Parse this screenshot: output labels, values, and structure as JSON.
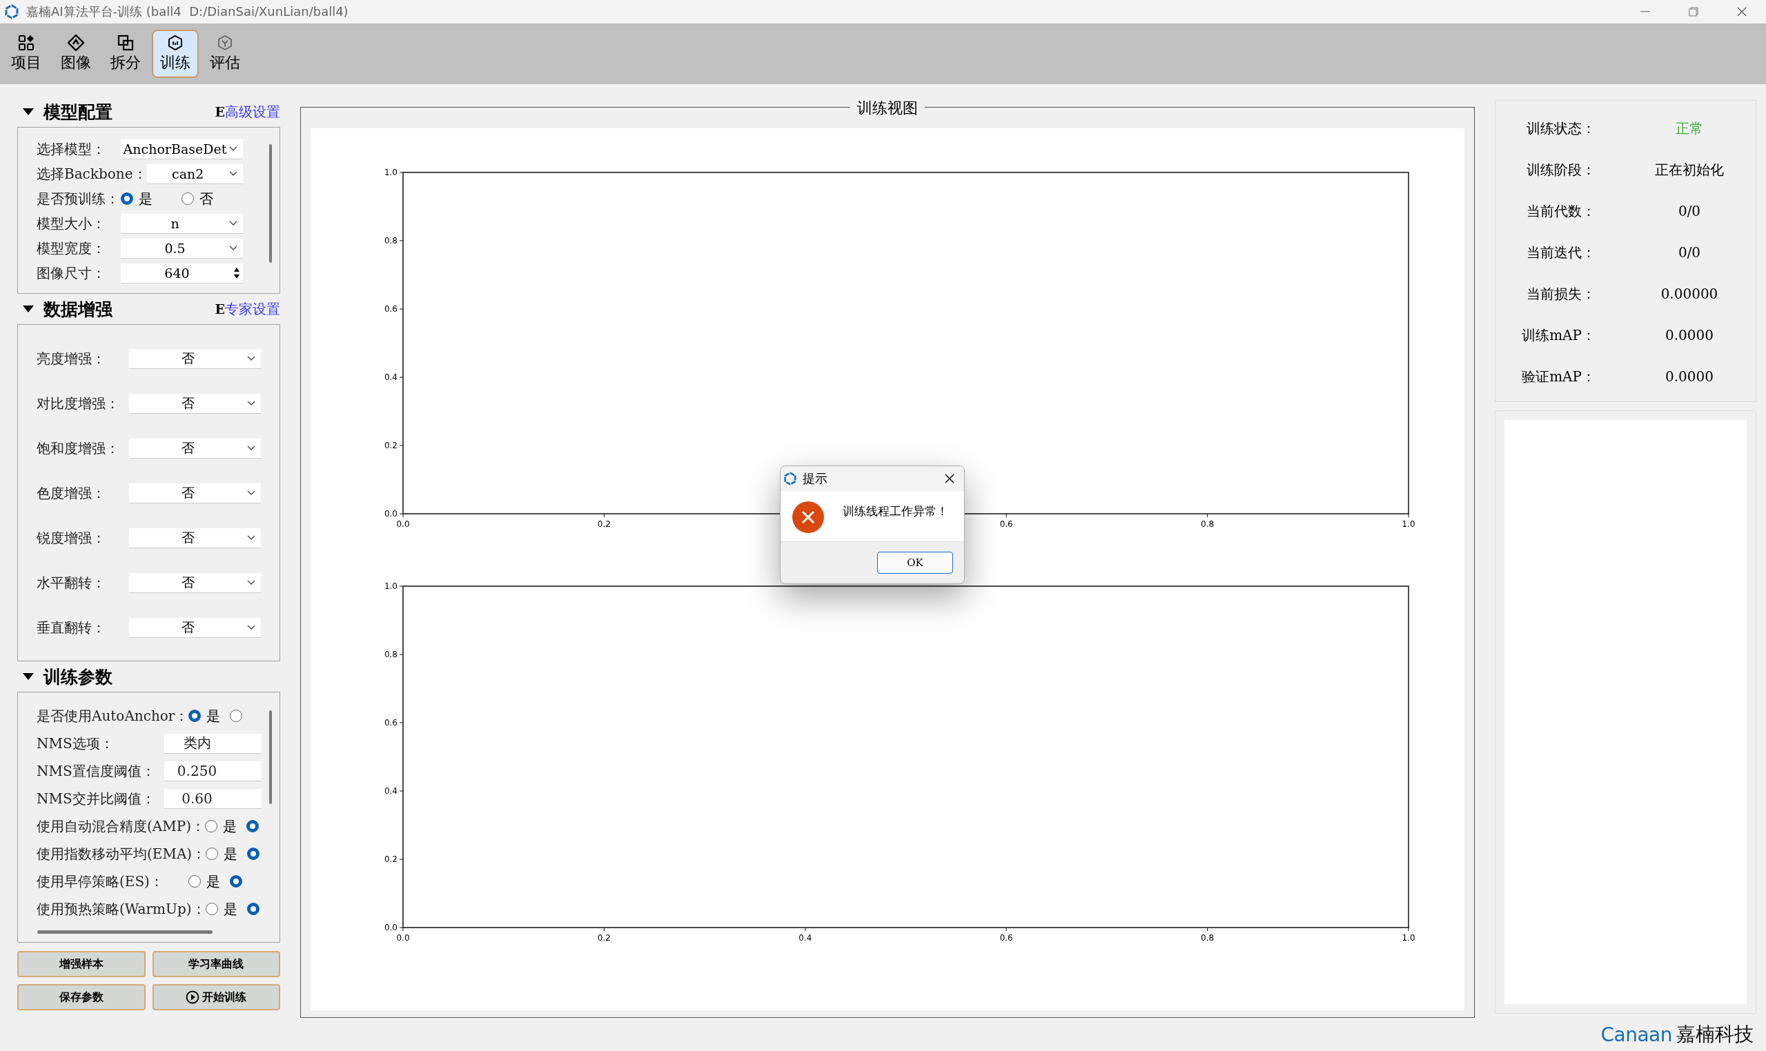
{
  "window": {
    "title": "嘉楠AI算法平台-训练 (ball4  D:/DianSai/XunLian/ball4)"
  },
  "toolbar": [
    {
      "label": "项目",
      "selected": false
    },
    {
      "label": "图像",
      "selected": false
    },
    {
      "label": "拆分",
      "selected": false
    },
    {
      "label": "训练",
      "selected": true
    },
    {
      "label": "评估",
      "selected": false
    }
  ],
  "model_config": {
    "title": "模型配置",
    "link_mark": "E",
    "link": "高级设置",
    "rows": [
      {
        "kind": "select",
        "label": "选择模型：",
        "value": "AnchorBaseDet"
      },
      {
        "kind": "select",
        "label": "选择Backbone：",
        "value": "can2"
      },
      {
        "kind": "radio",
        "label": "是否预训练：",
        "options": [
          {
            "label": "是",
            "selected": true
          },
          {
            "label": "否",
            "selected": false
          }
        ]
      },
      {
        "kind": "select",
        "label": "模型大小：",
        "value": "n"
      },
      {
        "kind": "select",
        "label": "模型宽度：",
        "value": "0.5"
      },
      {
        "kind": "spin",
        "label": "图像尺寸：",
        "value": "640"
      }
    ]
  },
  "augmentation": {
    "title": "数据增强",
    "link_mark": "E",
    "link": "专家设置",
    "rows": [
      {
        "label": "亮度增强：",
        "value": "否"
      },
      {
        "label": "对比度增强：",
        "value": "否"
      },
      {
        "label": "饱和度增强：",
        "value": "否"
      },
      {
        "label": "色度增强：",
        "value": "否"
      },
      {
        "label": "锐度增强：",
        "value": "否"
      },
      {
        "label": "水平翻转：",
        "value": "否"
      },
      {
        "label": "垂直翻转：",
        "value": "否"
      }
    ]
  },
  "train_params": {
    "title": "训练参数",
    "rows": [
      {
        "kind": "radio",
        "label": "是否使用AutoAnchor：",
        "options": [
          {
            "label": "是",
            "selected": true
          },
          {
            "selected": false
          }
        ]
      },
      {
        "kind": "field",
        "label": "NMS选项：",
        "value": "类内"
      },
      {
        "kind": "field",
        "label": "NMS置信度阈值：",
        "value": "0.250"
      },
      {
        "kind": "field",
        "label": "NMS交并比阈值：",
        "value": "0.60"
      },
      {
        "kind": "radio",
        "label": "使用自动混合精度(AMP)：",
        "options": [
          {
            "label": "是",
            "selected": false
          },
          {
            "selected": true
          }
        ]
      },
      {
        "kind": "radio",
        "label": "使用指数移动平均(EMA)：",
        "options": [
          {
            "label": "是",
            "selected": false
          },
          {
            "selected": true
          }
        ]
      },
      {
        "kind": "radio",
        "label": "使用早停策略(ES)：",
        "options": [
          {
            "label": "是",
            "selected": false
          },
          {
            "selected": true
          }
        ]
      },
      {
        "kind": "radio",
        "label": "使用预热策略(WarmUp)：",
        "options": [
          {
            "label": "是",
            "selected": false
          },
          {
            "selected": true
          }
        ]
      }
    ]
  },
  "actions": [
    {
      "kind": "plain",
      "label": "增强样本"
    },
    {
      "kind": "plain",
      "label": "学习率曲线"
    },
    {
      "kind": "plain",
      "label": "保存参数"
    },
    {
      "kind": "play",
      "label": "开始训练"
    }
  ],
  "view": {
    "title": "训练视图",
    "charts": [
      {
        "chart_data": {
          "type": "line",
          "xlim": [
            0,
            1
          ],
          "ylim": [
            0,
            1
          ],
          "xticks": [
            {
              "value": 0,
              "label": "0.0"
            },
            {
              "value": 0.2,
              "label": "0.2"
            },
            {
              "value": 0.6,
              "label": "0.6"
            },
            {
              "value": 0.8,
              "label": "0.8"
            },
            {
              "value": 1,
              "label": "1.0"
            }
          ],
          "yticks": [
            {
              "value": 0,
              "label": "0.0"
            },
            {
              "value": 0.2,
              "label": "0.2"
            },
            {
              "value": 0.4,
              "label": "0.4"
            },
            {
              "value": 0.6,
              "label": "0.6"
            },
            {
              "value": 0.8,
              "label": "0.8"
            },
            {
              "value": 1,
              "label": "1.0"
            }
          ]
        }
      },
      {
        "chart_data": {
          "type": "line",
          "xlim": [
            0,
            1
          ],
          "ylim": [
            0,
            1
          ],
          "xticks": [
            {
              "value": 0,
              "label": "0.0"
            },
            {
              "value": 0.2,
              "label": "0.2"
            },
            {
              "value": 0.4,
              "label": "0.4"
            },
            {
              "value": 0.6,
              "label": "0.6"
            },
            {
              "value": 0.8,
              "label": "0.8"
            },
            {
              "value": 1,
              "label": "1.0"
            }
          ],
          "yticks": [
            {
              "value": 0,
              "label": "0.0"
            },
            {
              "value": 0.2,
              "label": "0.2"
            },
            {
              "value": 0.4,
              "label": "0.4"
            },
            {
              "value": 0.6,
              "label": "0.6"
            },
            {
              "value": 0.8,
              "label": "0.8"
            },
            {
              "value": 1,
              "label": "1.0"
            }
          ]
        }
      }
    ]
  },
  "status": [
    {
      "label": "训练状态：",
      "value": "正常",
      "color": "#3aa83a"
    },
    {
      "label": "训练阶段：",
      "value": "正在初始化",
      "color": "#000000"
    },
    {
      "label": "当前代数：",
      "value": "0/0",
      "color": "#000000"
    },
    {
      "label": "当前迭代：",
      "value": "0/0",
      "color": "#000000"
    },
    {
      "label": "当前损失：",
      "value": "0.00000",
      "color": "#000000"
    },
    {
      "label": "训练mAP：",
      "value": "0.0000",
      "color": "#000000"
    },
    {
      "label": "验证mAP：",
      "value": "0.0000",
      "color": "#000000"
    }
  ],
  "dialog": {
    "title": "提示",
    "message": "训练线程工作异常！",
    "button": "OK"
  },
  "brand": {
    "latin": "Canaan",
    "name": "嘉楠科技"
  }
}
